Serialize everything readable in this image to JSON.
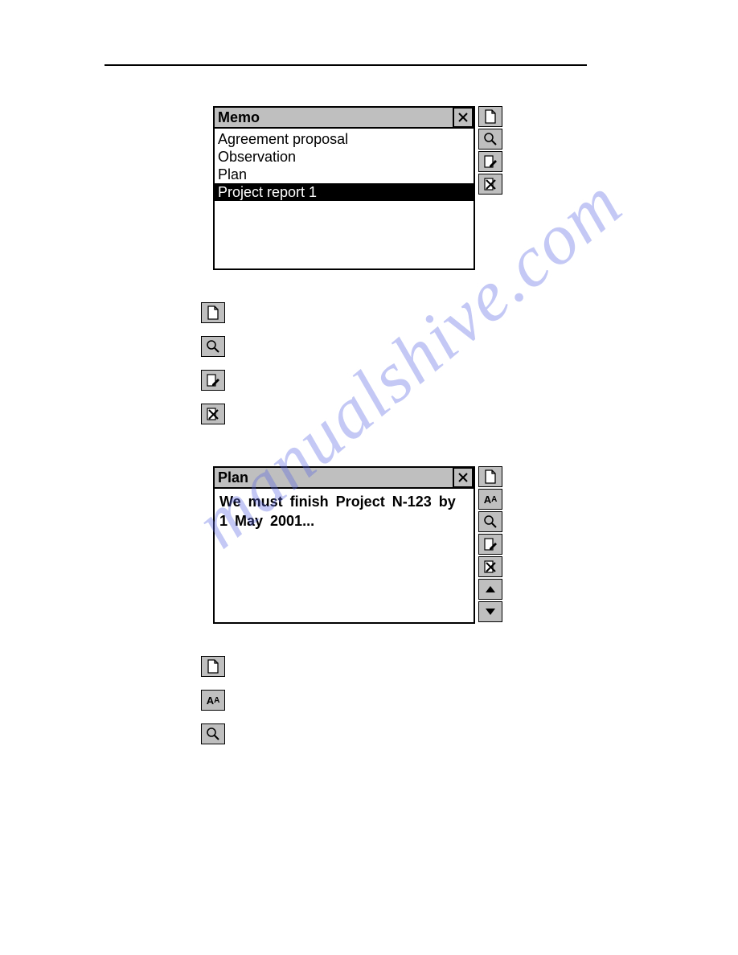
{
  "watermark": "manualshive.com",
  "memo_panel": {
    "title": "Memo",
    "items": [
      {
        "label": "Agreement proposal",
        "selected": false
      },
      {
        "label": "Observation",
        "selected": false
      },
      {
        "label": "Plan",
        "selected": false
      },
      {
        "label": "Project report 1",
        "selected": true
      }
    ],
    "sidebar": [
      "new",
      "search",
      "edit",
      "delete"
    ]
  },
  "plan_panel": {
    "title": "Plan",
    "body": "We must finish Project N-123 by 1 May 2001...",
    "sidebar": [
      "new",
      "font",
      "search",
      "edit",
      "delete",
      "up",
      "down"
    ]
  },
  "icon_list_1": [
    "new",
    "search",
    "edit",
    "delete"
  ],
  "icon_list_2": [
    "new",
    "font",
    "search"
  ]
}
